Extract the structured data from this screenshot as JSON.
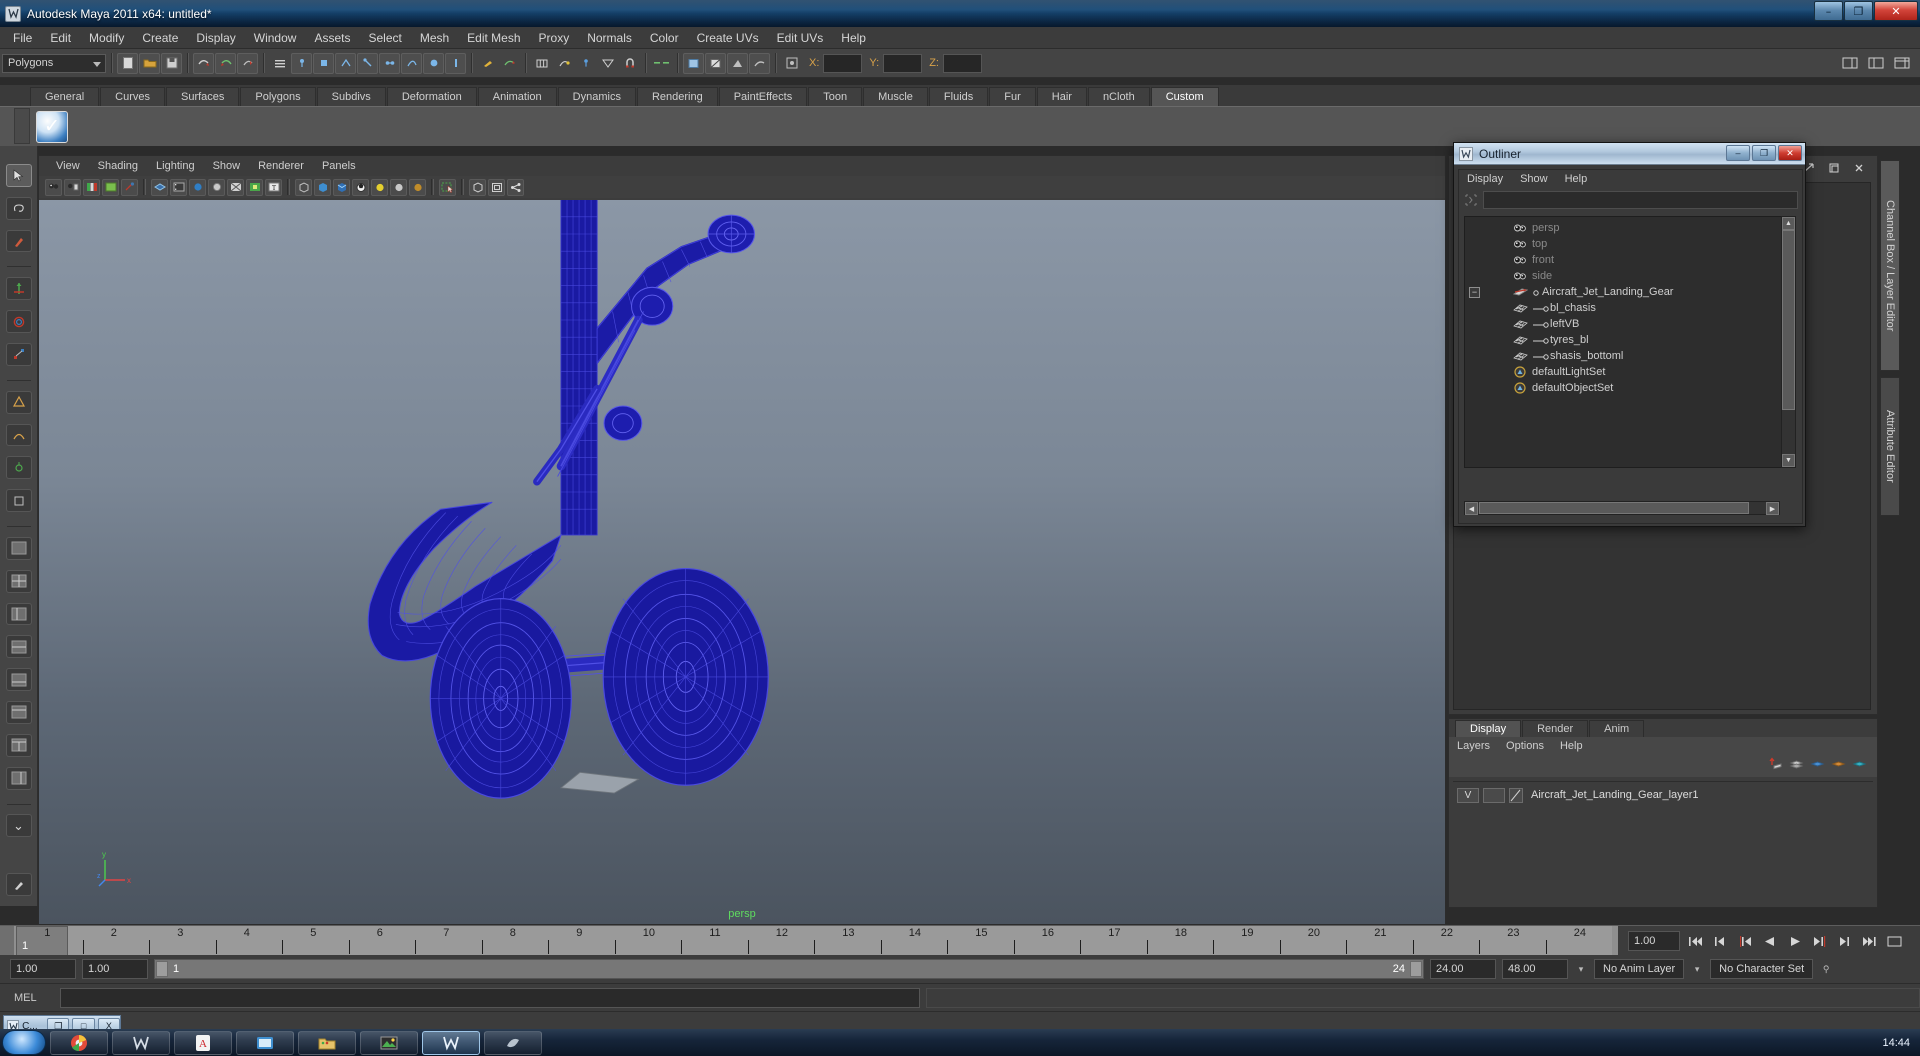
{
  "window": {
    "title": "Autodesk Maya 2011 x64: untitled*",
    "icon": "maya-icon",
    "buttons": {
      "minimize": "–",
      "maximize": "❐",
      "close": "✕"
    }
  },
  "menubar": {
    "items": [
      "File",
      "Edit",
      "Modify",
      "Create",
      "Display",
      "Window",
      "Assets",
      "Select",
      "Mesh",
      "Edit Mesh",
      "Proxy",
      "Normals",
      "Color",
      "Create UVs",
      "Edit UVs",
      "Help"
    ]
  },
  "statusline": {
    "mode_selected": "Polygons",
    "coord_labels": {
      "x": "X:",
      "y": "Y:",
      "z": "Z:"
    },
    "coord_values": {
      "x": "",
      "y": "",
      "z": ""
    }
  },
  "shelf": {
    "tabs": [
      "General",
      "Curves",
      "Surfaces",
      "Polygons",
      "Subdivs",
      "Deformation",
      "Animation",
      "Dynamics",
      "Rendering",
      "PaintEffects",
      "Toon",
      "Muscle",
      "Fluids",
      "Fur",
      "Hair",
      "nCloth",
      "Custom"
    ],
    "active_tab": "Custom"
  },
  "viewport": {
    "menu": [
      "View",
      "Shading",
      "Lighting",
      "Show",
      "Renderer",
      "Panels"
    ],
    "camera_label": "persp",
    "axis": {
      "y": "y",
      "x": "x",
      "z": "z"
    },
    "background_top": "#8b97a6",
    "background_bottom": "#4b545f",
    "wireframe_color": "#1a1a9e"
  },
  "outliner": {
    "title": "Outliner",
    "window_buttons": {
      "minimize": "–",
      "maximize": "❐",
      "close": "✕"
    },
    "menu": [
      "Display",
      "Show",
      "Help"
    ],
    "search_value": "",
    "tree": [
      {
        "name": "persp",
        "icon": "camera-icon",
        "indent": 1,
        "style": "dim",
        "expander": false,
        "connector": false
      },
      {
        "name": "top",
        "icon": "camera-icon",
        "indent": 1,
        "style": "dim",
        "expander": false,
        "connector": false
      },
      {
        "name": "front",
        "icon": "camera-icon",
        "indent": 1,
        "style": "dim",
        "expander": false,
        "connector": false
      },
      {
        "name": "side",
        "icon": "camera-icon",
        "indent": 1,
        "style": "dim",
        "expander": false,
        "connector": false
      },
      {
        "name": "Aircraft_Jet_Landing_Gear",
        "icon": "group-icon",
        "indent": 1,
        "style": "norm",
        "expander": true,
        "connector": false
      },
      {
        "name": "bl_chasis",
        "icon": "mesh-icon",
        "indent": 1,
        "style": "norm",
        "expander": false,
        "connector": true
      },
      {
        "name": "leftVB",
        "icon": "mesh-icon",
        "indent": 1,
        "style": "norm",
        "expander": false,
        "connector": true
      },
      {
        "name": "tyres_bl",
        "icon": "mesh-icon",
        "indent": 1,
        "style": "norm",
        "expander": false,
        "connector": true
      },
      {
        "name": "shasis_bottoml",
        "icon": "mesh-icon",
        "indent": 1,
        "style": "norm",
        "expander": false,
        "connector": true
      },
      {
        "name": "defaultLightSet",
        "icon": "set-icon",
        "indent": 1,
        "style": "norm",
        "expander": false,
        "connector": false
      },
      {
        "name": "defaultObjectSet",
        "icon": "set-icon",
        "indent": 1,
        "style": "norm",
        "expander": false,
        "connector": false
      }
    ]
  },
  "right_dock": {
    "side_tabs": [
      {
        "label": "Channel Box / Layer Editor",
        "active": true
      },
      {
        "label": "Attribute Editor",
        "active": false
      }
    ]
  },
  "layer_editor": {
    "tabs": [
      "Display",
      "Render",
      "Anim"
    ],
    "active_tab": "Display",
    "menu": [
      "Layers",
      "Options",
      "Help"
    ],
    "layers": [
      {
        "visibility": "V",
        "type": "",
        "name": "Aircraft_Jet_Landing_Gear_layer1"
      }
    ]
  },
  "time_slider": {
    "ticks": [
      "1",
      "2",
      "3",
      "4",
      "5",
      "6",
      "7",
      "8",
      "9",
      "10",
      "11",
      "12",
      "13",
      "14",
      "15",
      "16",
      "17",
      "18",
      "19",
      "20",
      "21",
      "22",
      "23",
      "24"
    ],
    "current_frame": "1",
    "current_time_field": "1.00",
    "playback_buttons": [
      "go-to-start",
      "step-back-key",
      "step-back-frame",
      "play-backwards",
      "play-forwards",
      "step-forward-frame",
      "step-forward-key",
      "go-to-end"
    ]
  },
  "range_slider": {
    "anim_start": "1.00",
    "range_start": "1.00",
    "bar_start_label": "1",
    "bar_end_label": "24",
    "range_end": "24.00",
    "anim_end": "48.00",
    "anim_layer": "No Anim Layer",
    "character_set": "No Character Set"
  },
  "command_line": {
    "label": "MEL",
    "value": "",
    "result": ""
  },
  "minimized_window": {
    "title": "C...",
    "buttons": {
      "restore": "❐",
      "maximize": "□",
      "close": "X"
    }
  },
  "taskbar": {
    "start": "start-orb",
    "items": [
      "chrome-icon",
      "maya-icon",
      "acrobat-icon",
      "explorer-icon",
      "folder-icon",
      "photos-icon",
      "maya-active-icon",
      "app-icon"
    ],
    "clock": "14:44"
  }
}
